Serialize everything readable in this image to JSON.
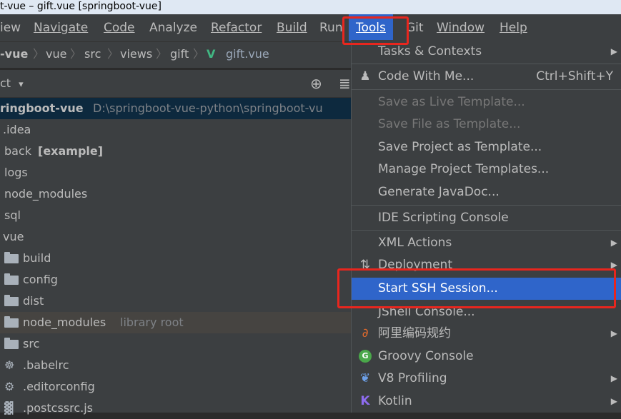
{
  "titlebar": {
    "text": "t-vue – gift.vue [springboot-vue]"
  },
  "menu": {
    "view": "iew",
    "navigate": "Navigate",
    "code": "Code",
    "analyze": "Analyze",
    "refactor": "Refactor",
    "build": "Build",
    "run": "Run",
    "tools": "Tools",
    "git": "Git",
    "window": "Window",
    "help": "Help"
  },
  "breadcrumb": {
    "root": "-vue",
    "seg1": "vue",
    "seg2": "src",
    "seg3": "views",
    "seg4": "gift",
    "file_icon": "V",
    "file": "gift.vue"
  },
  "project_panel": {
    "title": "ct",
    "dropdown_arrow": "▾",
    "locate_icon": "⊕",
    "collapse_icon": "≣"
  },
  "tree": {
    "root_name": "ringboot-vue",
    "root_path": "D:\\springboot-vue-python\\springboot-vu",
    "items": [
      {
        "label": ".idea"
      },
      {
        "label": "back",
        "tag": "[example]"
      },
      {
        "label": "logs"
      },
      {
        "label": "node_modules"
      },
      {
        "label": "sql"
      },
      {
        "label": "vue"
      },
      {
        "label": "build"
      },
      {
        "label": "config"
      },
      {
        "label": "dist"
      },
      {
        "label": "node_modules",
        "tag": "library root"
      },
      {
        "label": "src"
      },
      {
        "label": ".babelrc"
      },
      {
        "label": ".editorconfig"
      },
      {
        "label": ".postcssrc.js"
      }
    ]
  },
  "tools_menu": {
    "tasks": "Tasks & Contexts",
    "code_with_me": "Code With Me...",
    "code_with_me_shortcut": "Ctrl+Shift+Y",
    "save_live_template": "Save as Live Template...",
    "save_file_template": "Save File as Template...",
    "save_project_template": "Save Project as Template...",
    "manage_project_templates": "Manage Project Templates...",
    "generate_javadoc": "Generate JavaDoc...",
    "ide_scripting_console": "IDE Scripting Console",
    "xml_actions": "XML Actions",
    "deployment": "Deployment",
    "start_ssh": "Start SSH Session...",
    "jshell": "JShell Console...",
    "alibaba": "阿里编码规约",
    "groovy": "Groovy Console",
    "v8": "V8 Profiling",
    "kotlin": "Kotlin"
  },
  "colors": {
    "accent": "#2f65ca",
    "highlight_box": "#e8261e",
    "vue_green": "#41b883",
    "panel_bg": "#3c3f41"
  },
  "icons": {
    "submenu_arrow": "▶",
    "code_with_me_icon": "♟",
    "deployment_icon": "⇅",
    "alibaba_icon": "∂",
    "groovy_icon": "G",
    "v8_icon": "❦",
    "kotlin_icon": "K",
    "gear_icon": "⚙",
    "babel_icon": "☸",
    "postcss_icon": "▓"
  }
}
